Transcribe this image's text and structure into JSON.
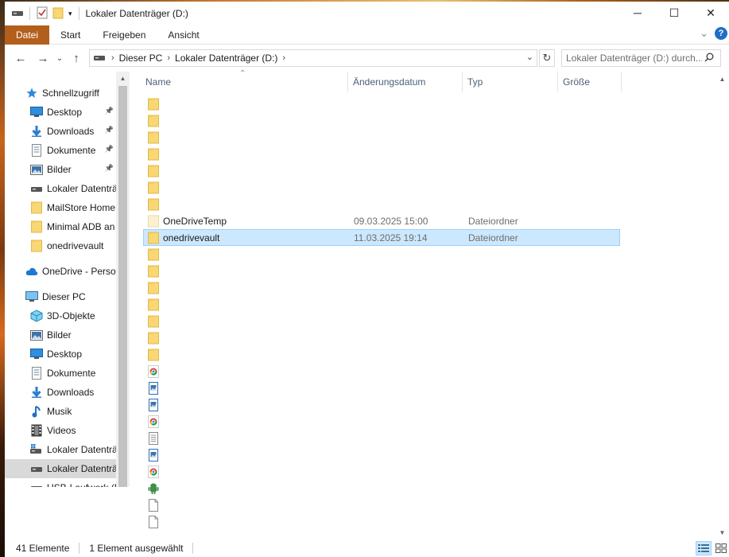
{
  "window": {
    "title": "Lokaler Datenträger (D:)",
    "controls": {
      "minimize": "─",
      "maximize": "☐",
      "close": "✕"
    }
  },
  "ribbon": {
    "tabs": [
      "Datei",
      "Start",
      "Freigeben",
      "Ansicht"
    ],
    "help": "?",
    "expand": "⌄"
  },
  "nav": {
    "back": "←",
    "forward": "→",
    "recent": "⌄",
    "up": "↑",
    "breadcrumb": [
      "Dieser PC",
      "Lokaler Datenträger (D:)"
    ],
    "refresh": "↻"
  },
  "search": {
    "placeholder": "Lokaler Datenträger (D:) durch...",
    "icon": "search-icon"
  },
  "sidebar": {
    "quick_access": {
      "label": "Schnellzugriff",
      "icon": "star-icon"
    },
    "quick_items": [
      {
        "label": "Desktop",
        "icon": "desktop-icon",
        "pinned": true
      },
      {
        "label": "Downloads",
        "icon": "download-icon",
        "pinned": true
      },
      {
        "label": "Dokumente",
        "icon": "document-icon",
        "pinned": true
      },
      {
        "label": "Bilder",
        "icon": "pictures-icon",
        "pinned": true
      },
      {
        "label": "Lokaler Datenträ",
        "icon": "drive-icon",
        "pinned": false
      },
      {
        "label": "MailStore Home",
        "icon": "folder-icon",
        "pinned": false
      },
      {
        "label": "Minimal ADB an",
        "icon": "folder-icon",
        "pinned": false
      },
      {
        "label": "onedrivevault",
        "icon": "folder-icon",
        "pinned": false
      }
    ],
    "onedrive": {
      "label": "OneDrive - Persor",
      "icon": "cloud-icon"
    },
    "this_pc": {
      "label": "Dieser PC",
      "icon": "computer-icon"
    },
    "pc_items": [
      {
        "label": "3D-Objekte",
        "icon": "cube-icon"
      },
      {
        "label": "Bilder",
        "icon": "pictures-icon"
      },
      {
        "label": "Desktop",
        "icon": "desktop-icon"
      },
      {
        "label": "Dokumente",
        "icon": "document-icon"
      },
      {
        "label": "Downloads",
        "icon": "download-icon"
      },
      {
        "label": "Musik",
        "icon": "music-icon"
      },
      {
        "label": "Videos",
        "icon": "video-icon"
      },
      {
        "label": "Lokaler Datenträ",
        "icon": "os-drive-icon"
      },
      {
        "label": "Lokaler Datenträ",
        "icon": "drive-icon",
        "selected": true
      },
      {
        "label": "USB-Laufwerk (E",
        "icon": "usb-icon"
      }
    ]
  },
  "columns": {
    "name": "Name",
    "modified": "Änderungsdatum",
    "type": "Typ",
    "size": "Größe"
  },
  "files": [
    {
      "name": "",
      "date": "",
      "type": "",
      "icon": "folder-icon"
    },
    {
      "name": "",
      "date": "",
      "type": "",
      "icon": "folder-icon"
    },
    {
      "name": "",
      "date": "",
      "type": "",
      "icon": "folder-icon"
    },
    {
      "name": "",
      "date": "",
      "type": "",
      "icon": "folder-icon"
    },
    {
      "name": "",
      "date": "",
      "type": "",
      "icon": "folder-icon"
    },
    {
      "name": "",
      "date": "",
      "type": "",
      "icon": "folder-icon"
    },
    {
      "name": "",
      "date": "",
      "type": "",
      "icon": "folder-icon"
    },
    {
      "name": "OneDriveTemp",
      "date": "09.03.2025 15:00",
      "type": "Dateiordner",
      "icon": "folder-empty-icon"
    },
    {
      "name": "onedrivevault",
      "date": "11.03.2025 19:14",
      "type": "Dateiordner",
      "icon": "folder-icon",
      "selected": true
    },
    {
      "name": "",
      "date": "",
      "type": "",
      "icon": "folder-icon"
    },
    {
      "name": "",
      "date": "",
      "type": "",
      "icon": "folder-icon"
    },
    {
      "name": "",
      "date": "",
      "type": "",
      "icon": "folder-icon"
    },
    {
      "name": "",
      "date": "",
      "type": "",
      "icon": "folder-icon"
    },
    {
      "name": "",
      "date": "",
      "type": "",
      "icon": "folder-icon"
    },
    {
      "name": "",
      "date": "",
      "type": "",
      "icon": "folder-icon"
    },
    {
      "name": "",
      "date": "",
      "type": "",
      "icon": "folder-icon"
    },
    {
      "name": "",
      "date": "",
      "type": "",
      "icon": "chrome-icon"
    },
    {
      "name": "",
      "date": "",
      "type": "",
      "icon": "image-file-icon"
    },
    {
      "name": "",
      "date": "",
      "type": "",
      "icon": "image-file-icon"
    },
    {
      "name": "",
      "date": "",
      "type": "",
      "icon": "chrome-icon"
    },
    {
      "name": "",
      "date": "",
      "type": "",
      "icon": "text-file-icon"
    },
    {
      "name": "",
      "date": "",
      "type": "",
      "icon": "image-file-icon"
    },
    {
      "name": "",
      "date": "",
      "type": "",
      "icon": "chrome-icon"
    },
    {
      "name": "",
      "date": "",
      "type": "",
      "icon": "android-icon"
    },
    {
      "name": "",
      "date": "",
      "type": "",
      "icon": "blank-file-icon"
    },
    {
      "name": "",
      "date": "",
      "type": "",
      "icon": "blank-file-icon"
    }
  ],
  "status": {
    "count": "41 Elemente",
    "selection": "1 Element ausgewählt"
  },
  "colors": {
    "accent": "#b35f1c",
    "selection": "#cce8ff",
    "selection_border": "#99d1ff",
    "header_text": "#4c607a",
    "folder": "#f8d775"
  }
}
